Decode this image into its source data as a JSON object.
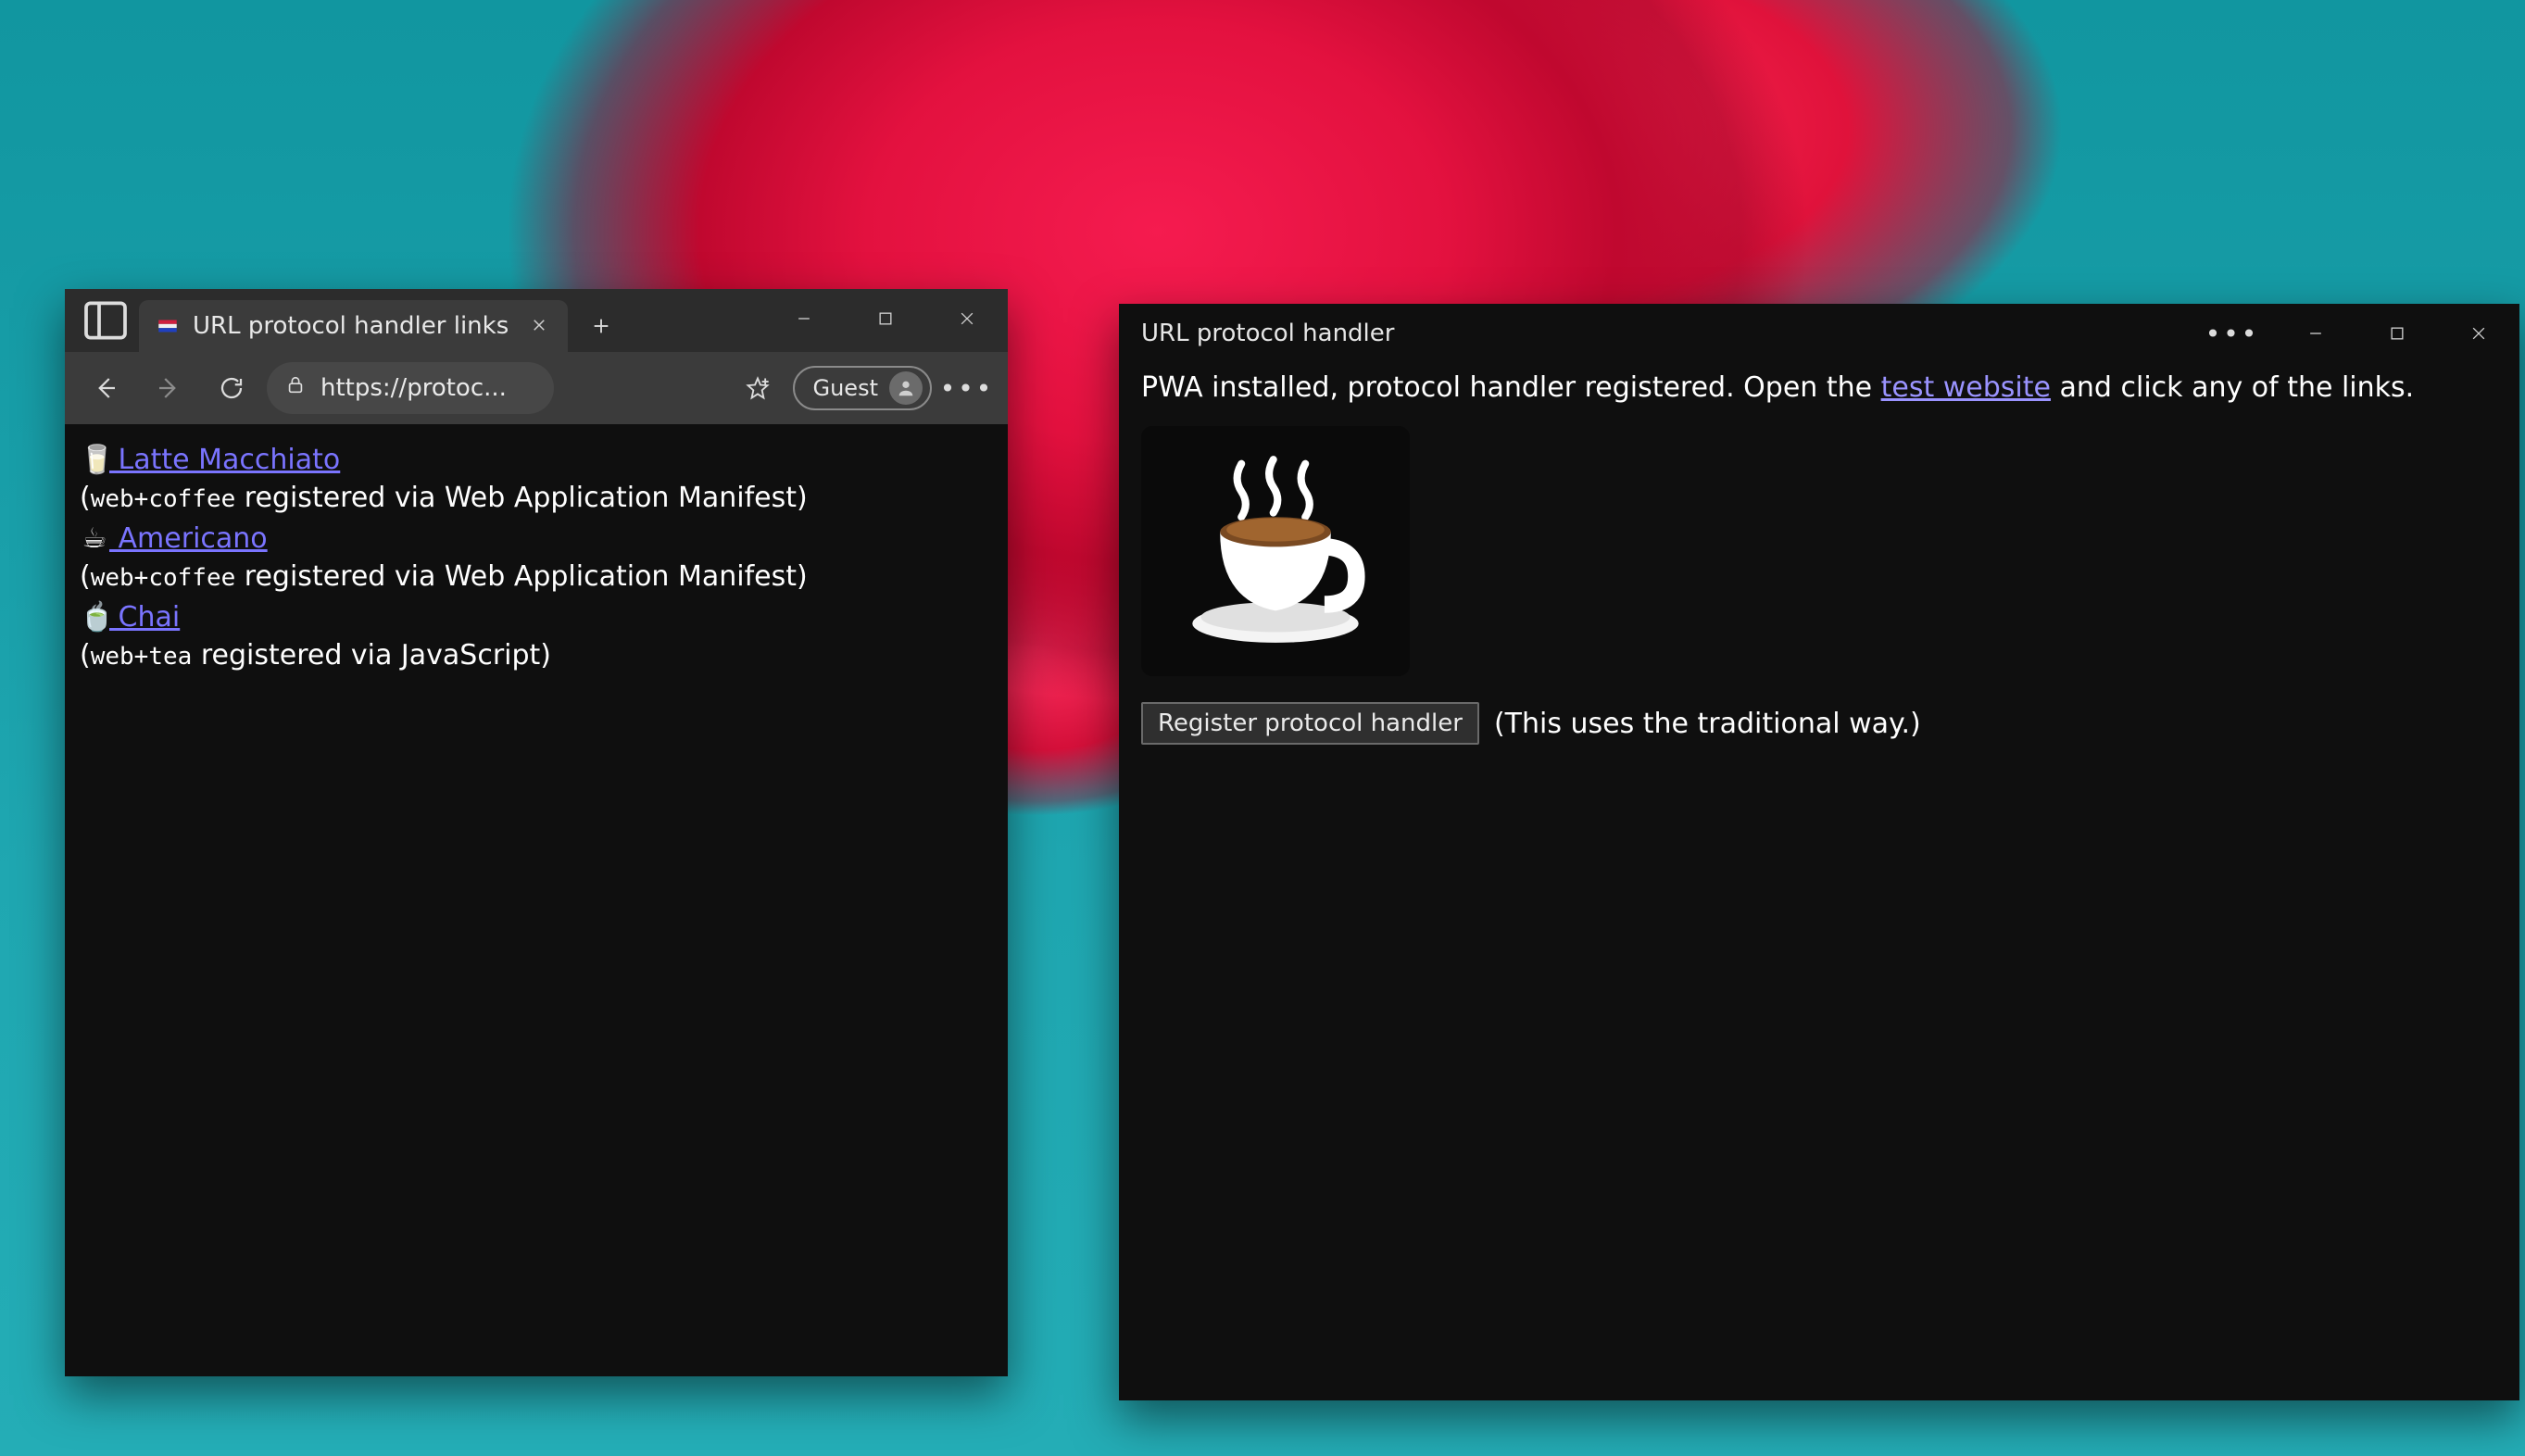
{
  "browser": {
    "tab_title": "URL protocol handler links",
    "address": "https://protoc...",
    "guest_label": "Guest",
    "links": [
      {
        "emoji": "🥛",
        "label": " Latte Macchiato",
        "reg_open": "(",
        "reg_code": "web+coffee",
        "reg_text": " registered via Web Application Manifest)"
      },
      {
        "emoji": "☕",
        "label": " Americano",
        "reg_open": "(",
        "reg_code": "web+coffee",
        "reg_text": " registered via Web Application Manifest)"
      },
      {
        "emoji": "🍵",
        "label": " Chai",
        "reg_open": "(",
        "reg_code": "web+tea",
        "reg_text": " registered via JavaScript)"
      }
    ]
  },
  "pwa": {
    "title": "URL protocol handler",
    "intro_before": "PWA installed, protocol handler registered. Open the ",
    "intro_link": "test website",
    "intro_after": " and click any of the links.",
    "button_label": "Register protocol handler",
    "button_note": "(This uses the traditional way.)"
  }
}
